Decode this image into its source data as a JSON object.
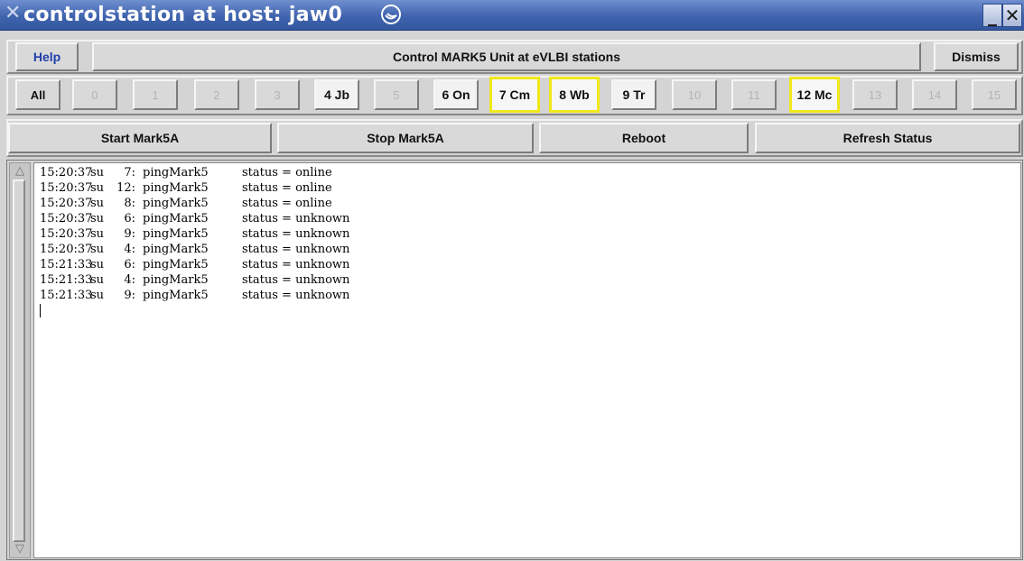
{
  "window": {
    "title": "controlstation at host: jaw0"
  },
  "toolbar": {
    "help_label": "Help",
    "heading": "Control MARK5 Unit at eVLBI stations",
    "dismiss_label": "Dismiss"
  },
  "units": {
    "all_label": "All",
    "items": [
      {
        "label": "0",
        "state": "disabled"
      },
      {
        "label": "1",
        "state": "disabled"
      },
      {
        "label": "2",
        "state": "disabled"
      },
      {
        "label": "3",
        "state": "disabled"
      },
      {
        "label": "4 Jb",
        "state": "active"
      },
      {
        "label": "5",
        "state": "disabled"
      },
      {
        "label": "6 On",
        "state": "active"
      },
      {
        "label": "7 Cm",
        "state": "selected"
      },
      {
        "label": "8 Wb",
        "state": "selected"
      },
      {
        "label": "9 Tr",
        "state": "active"
      },
      {
        "label": "10",
        "state": "disabled"
      },
      {
        "label": "11",
        "state": "disabled"
      },
      {
        "label": "12 Mc",
        "state": "selected"
      },
      {
        "label": "13",
        "state": "disabled"
      },
      {
        "label": "14",
        "state": "disabled"
      },
      {
        "label": "15",
        "state": "disabled"
      }
    ]
  },
  "actions": {
    "start_label": "Start Mark5A",
    "stop_label": "Stop Mark5A",
    "reboot_label": "Reboot",
    "refresh_label": "Refresh Status"
  },
  "log": {
    "lines": [
      {
        "time": "15:20:37",
        "user": "su",
        "unit": "7:",
        "cmd": "pingMark5",
        "status": "status = online"
      },
      {
        "time": "15:20:37",
        "user": "su",
        "unit": "12:",
        "cmd": "pingMark5",
        "status": "status = online"
      },
      {
        "time": "15:20:37",
        "user": "su",
        "unit": "8:",
        "cmd": "pingMark5",
        "status": "status = online"
      },
      {
        "time": "15:20:37",
        "user": "su",
        "unit": "6:",
        "cmd": "pingMark5",
        "status": "status = unknown"
      },
      {
        "time": "15:20:37",
        "user": "su",
        "unit": "9:",
        "cmd": "pingMark5",
        "status": "status = unknown"
      },
      {
        "time": "15:20:37",
        "user": "su",
        "unit": "4:",
        "cmd": "pingMark5",
        "status": "status = unknown"
      },
      {
        "time": "15:21:33",
        "user": "su",
        "unit": "6:",
        "cmd": "pingMark5",
        "status": "status = unknown"
      },
      {
        "time": "15:21:33",
        "user": "su",
        "unit": "4:",
        "cmd": "pingMark5",
        "status": "status = unknown"
      },
      {
        "time": "15:21:33",
        "user": "su",
        "unit": "9:",
        "cmd": "pingMark5",
        "status": "status = unknown"
      }
    ]
  },
  "colors": {
    "titlebar": "#3f63ad",
    "selected_border": "#f0e81a",
    "help_text": "#1f3faa"
  }
}
